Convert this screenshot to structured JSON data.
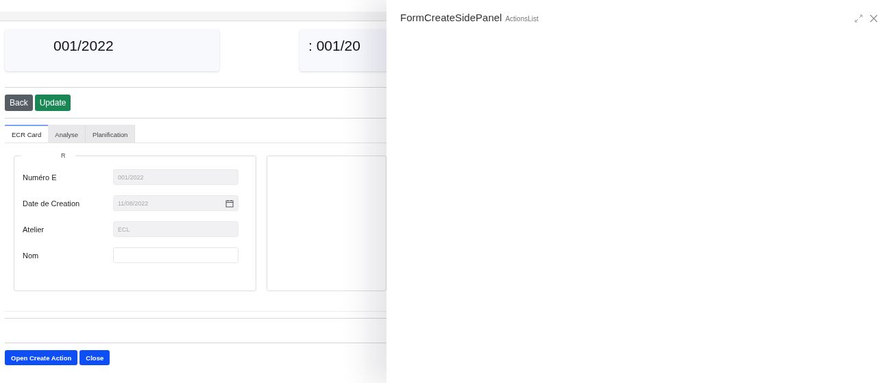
{
  "cards": [
    {
      "text": "001/2022"
    },
    {
      "text": ": 001/20"
    }
  ],
  "actions": [
    {
      "label": "Back",
      "kind": "secondary"
    },
    {
      "label": "Update",
      "kind": "success"
    }
  ],
  "tabs": [
    {
      "label": "ECR Card",
      "selected": true
    },
    {
      "label": "Analyse",
      "selected": false
    },
    {
      "label": "Planification",
      "selected": false
    }
  ],
  "form": {
    "legend": "R",
    "fields": [
      {
        "label": "Numéro E",
        "value": "001/2022",
        "disabled": true,
        "kind": "text"
      },
      {
        "label": "Date de Creation",
        "value": "11/08/2022",
        "disabled": true,
        "kind": "date"
      },
      {
        "label": "Atelier",
        "value": "ECL",
        "disabled": true,
        "kind": "text"
      },
      {
        "label": "Nom",
        "disabled": false,
        "kind": "text"
      }
    ]
  },
  "footer_buttons": [
    "Open Create Action",
    "Close"
  ],
  "side_panel": {
    "title": "FormCreateSidePanel",
    "subtitle": "ActionsList"
  }
}
